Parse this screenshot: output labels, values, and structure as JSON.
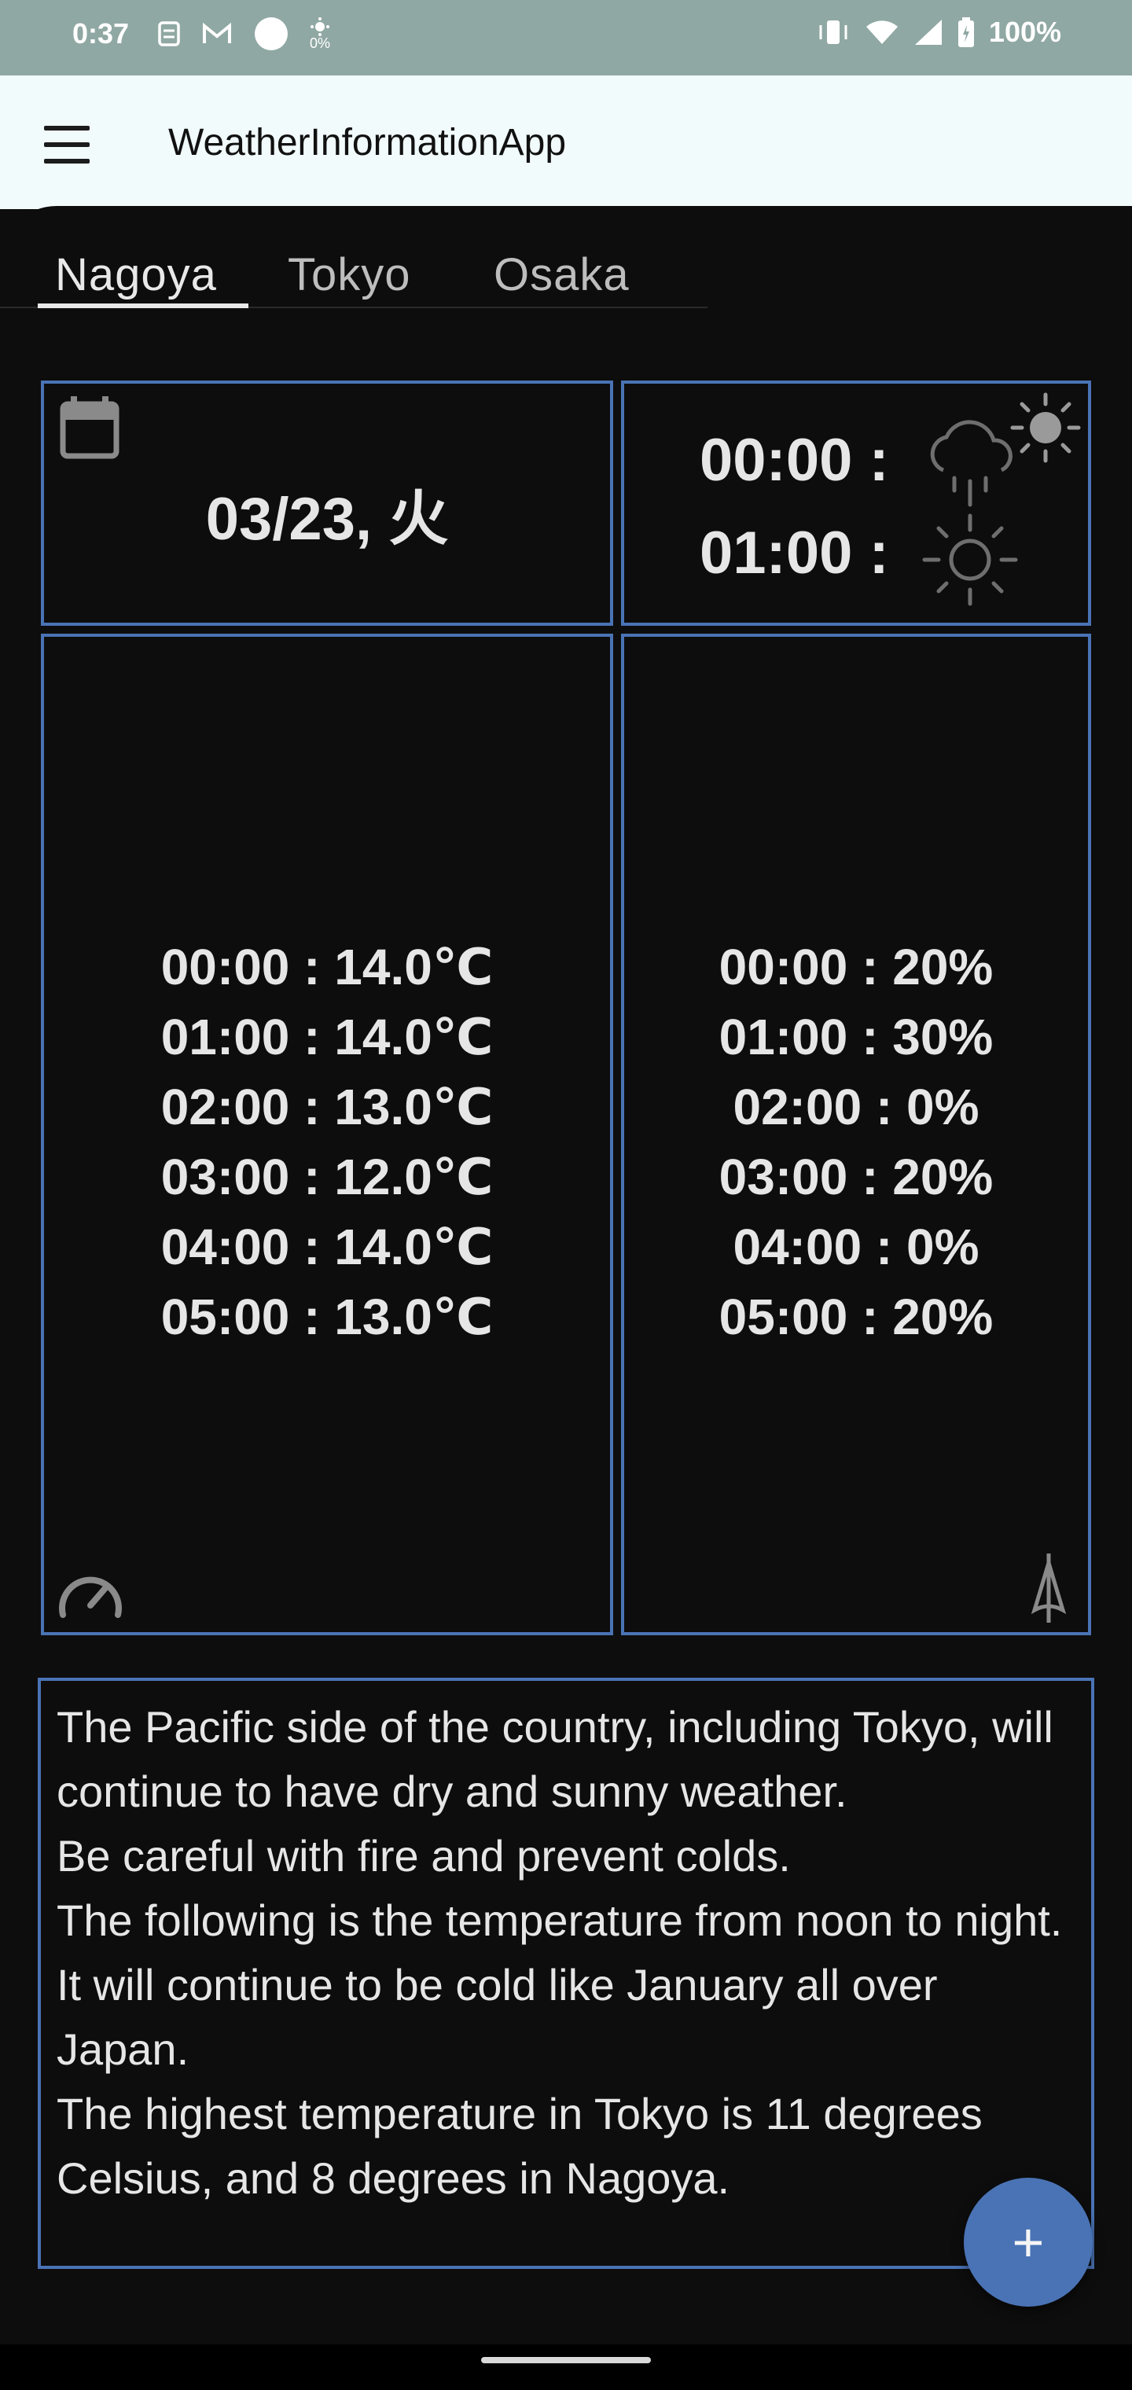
{
  "status_bar": {
    "time": "0:37",
    "left_icons": [
      "sim-icon",
      "gmail-icon",
      "circle-icon",
      "brightness-icon"
    ],
    "brightness_label": "0%",
    "battery": "100%"
  },
  "app_bar": {
    "title": "WeatherInformationApp",
    "menu_icon": "hamburger-menu-icon"
  },
  "tabs": [
    {
      "label": "Nagoya",
      "active": true
    },
    {
      "label": "Tokyo",
      "active": false
    },
    {
      "label": "Osaka",
      "active": false
    }
  ],
  "date_card": {
    "icon": "calendar-icon",
    "date": "03/23, 火"
  },
  "weather_card": {
    "corner_icon": "sun-icon",
    "rows": [
      {
        "label": "00:00 :",
        "icon": "rain-snow-cloud-icon"
      },
      {
        "label": "01:00 :",
        "icon": "sun-outline-icon"
      }
    ]
  },
  "temperature_card": {
    "icon": "speedometer-icon",
    "items": [
      "00:00 : 14.0℃",
      "01:00 : 14.0℃",
      "02:00 : 13.0℃",
      "03:00 : 12.0℃",
      "04:00 : 14.0℃",
      "05:00 : 13.0℃"
    ]
  },
  "precipitation_card": {
    "icon": "umbrella-icon",
    "items": [
      "00:00 : 20%",
      "01:00 : 30%",
      "02:00 : 0%",
      "03:00 : 20%",
      "04:00 : 0%",
      "05:00 : 20%"
    ]
  },
  "forecast": {
    "text": "The Pacific side of the country, including Tokyo, will continue to have dry and sunny weather.\nBe careful with fire and prevent colds.\nThe following is the temperature from noon to night.\nIt will continue to be cold like January all over Japan.\nThe highest temperature in Tokyo is 11 degrees Celsius, and 8 degrees in Nagoya."
  },
  "fab": {
    "label": "+",
    "icon": "plus-icon"
  },
  "colors": {
    "status_bar": "#90a8a3",
    "app_bar": "#f1fbfb",
    "background": "#0d0d0d",
    "card_border": "#4a73b5",
    "fab": "#4a73b5",
    "text": "#e6e6e6"
  }
}
